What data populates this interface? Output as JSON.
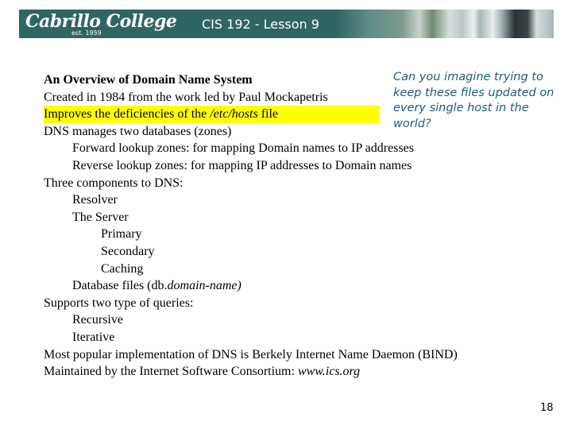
{
  "header": {
    "logo_text": "Cabrillo College",
    "logo_subtext": "est. 1959",
    "title": "CIS 192 - Lesson 9",
    "banner_color": "#2f6563"
  },
  "slide": {
    "heading": "An Overview of Domain Name System",
    "lines": [
      {
        "level": 0,
        "text": "Created in 1984 from the work led by Paul Mockapetris"
      },
      {
        "level": 0,
        "text_before": "Improves the deficiencies of the ",
        "italic": "/etc/hosts",
        "text_after": " file",
        "highlight": "#ffff00"
      },
      {
        "level": 0,
        "text": "DNS manages two databases (zones)"
      },
      {
        "level": 1,
        "text": "Forward lookup zones: for mapping Domain names to IP addresses"
      },
      {
        "level": 1,
        "text": "Reverse lookup zones: for mapping IP addresses to Domain names"
      },
      {
        "level": 0,
        "text": "Three components to DNS:"
      },
      {
        "level": 1,
        "text": "Resolver"
      },
      {
        "level": 1,
        "text": "The Server"
      },
      {
        "level": 2,
        "text": "Primary"
      },
      {
        "level": 2,
        "text": "Secondary"
      },
      {
        "level": 2,
        "text": "Caching"
      },
      {
        "level": 1,
        "text_before": "Database files (db.",
        "italic": "domain-name)",
        "text_after": ""
      },
      {
        "level": 0,
        "text": "Supports two type of queries:"
      },
      {
        "level": 1,
        "text": "Recursive"
      },
      {
        "level": 1,
        "text": "Iterative"
      },
      {
        "level": 0,
        "text": "Most popular implementation of DNS is Berkely Internet Name Daemon (BIND)"
      },
      {
        "level": 0,
        "text_before": "Maintained by the Internet Software Consortium: ",
        "italic": "www.ics.org",
        "text_after": ""
      }
    ],
    "callout": "Can you imagine trying to keep these files updated on every single host in the world?",
    "callout_color": "#1f5a7a",
    "page_number": "18"
  }
}
